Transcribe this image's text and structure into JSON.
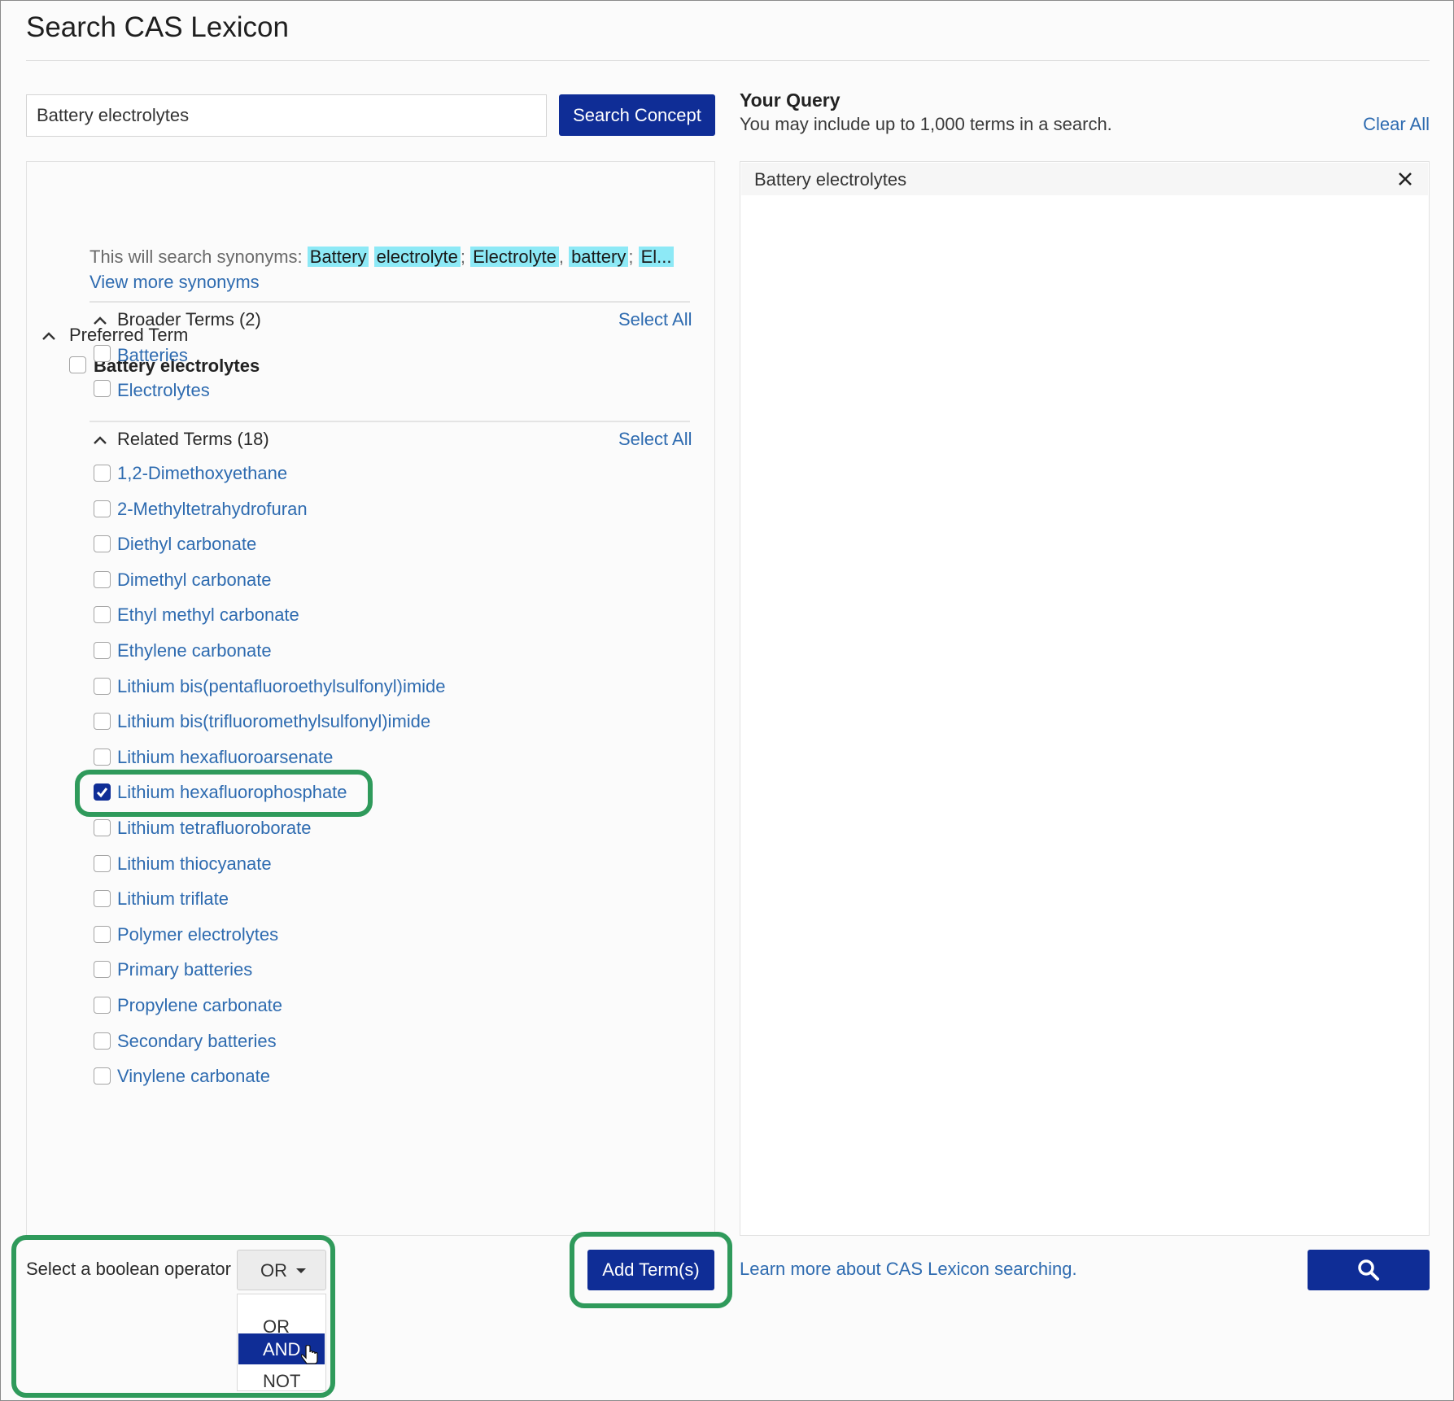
{
  "page": {
    "title": "Search CAS Lexicon"
  },
  "search": {
    "value": "Battery electrolytes",
    "button_label": "Search Concept"
  },
  "query": {
    "title": "Your Query",
    "subtitle": "You may include up to 1,000 terms in a search.",
    "clear_all_label": "Clear All",
    "items": [
      "Battery electrolytes"
    ]
  },
  "preferred": {
    "heading": "Preferred Term",
    "term": "Battery electrolytes",
    "synonyms_prefix": "This will search synonyms:",
    "synonyms": [
      "Battery",
      "electrolyte",
      "Electrolyte",
      "battery",
      "El..."
    ],
    "view_more_label": "View more synonyms"
  },
  "broader": {
    "heading": "Broader Terms (2)",
    "select_all_label": "Select All",
    "terms": [
      "Batteries",
      "Electrolytes"
    ]
  },
  "related": {
    "heading": "Related Terms (18)",
    "select_all_label": "Select All",
    "terms": [
      "1,2-Dimethoxyethane",
      "2-Methyltetrahydrofuran",
      "Diethyl carbonate",
      "Dimethyl carbonate",
      "Ethyl methyl carbonate",
      "Ethylene carbonate",
      "Lithium bis(pentafluoroethylsulfonyl)imide",
      "Lithium bis(trifluoromethylsulfonyl)imide",
      "Lithium hexafluoroarsenate",
      "Lithium hexafluorophosphate",
      "Lithium tetrafluoroborate",
      "Lithium thiocyanate",
      "Lithium triflate",
      "Polymer electrolytes",
      "Primary batteries",
      "Propylene carbonate",
      "Secondary batteries",
      "Vinylene carbonate"
    ],
    "checked": "Lithium hexafluorophosphate"
  },
  "boolean": {
    "label": "Select a boolean operator",
    "value": "OR",
    "options": [
      "OR",
      "AND",
      "NOT"
    ],
    "highlighted": "AND"
  },
  "footer": {
    "add_terms_label": "Add Term(s)",
    "learn_more_label": "Learn more about CAS Lexicon searching."
  },
  "colors": {
    "primary": "#0f2d96",
    "link": "#2e6bb0",
    "highlight": "#8de9f6",
    "callout": "#2f9a5b"
  }
}
